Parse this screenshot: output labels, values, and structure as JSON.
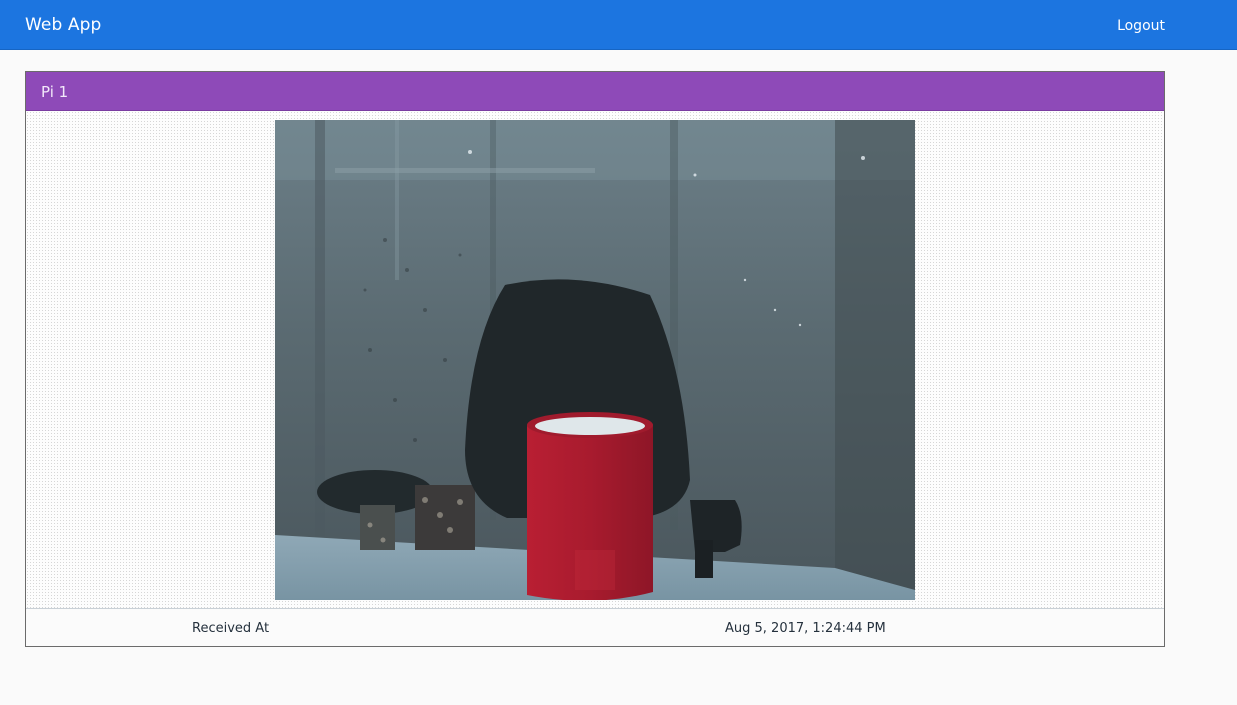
{
  "navbar": {
    "brand": "Web App",
    "logout_label": "Logout",
    "color": "#1c75e0"
  },
  "panel": {
    "title": "Pi 1",
    "header_color": "#8e4ab8",
    "image": {
      "subject": "webcam photo of a black office chair with a red cup in front of a frosted glass wall"
    },
    "footer": {
      "label": "Received At",
      "value": "Aug 5, 2017, 1:24:44 PM"
    }
  }
}
